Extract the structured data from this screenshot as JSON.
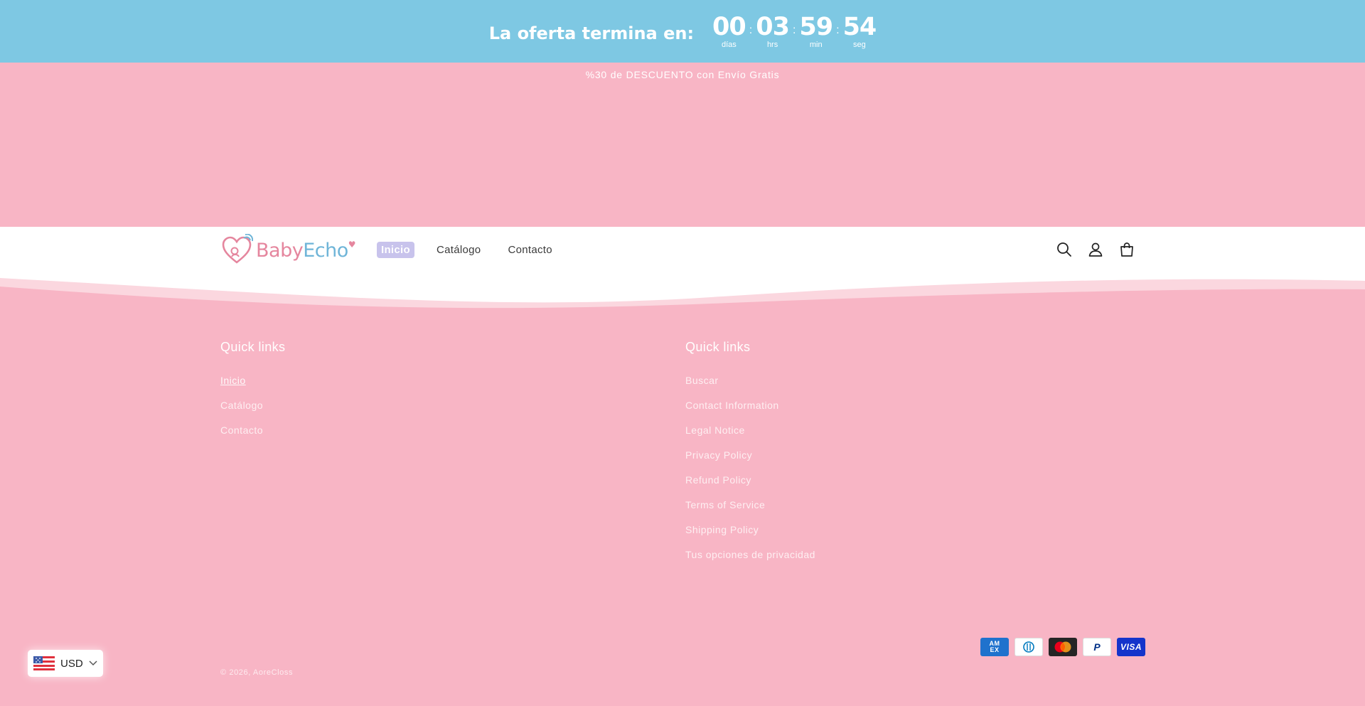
{
  "countdown": {
    "title": "La oferta termina en:",
    "days": {
      "value": "00",
      "label": "días"
    },
    "hours": {
      "value": "03",
      "label": "hrs"
    },
    "minutes": {
      "value": "59",
      "label": "min"
    },
    "seconds": {
      "value": "54",
      "label": "seg"
    },
    "separator": ":"
  },
  "announcement": "%30 de DESCUENTO con Envío Gratis",
  "header": {
    "logo": {
      "part1": "Baby",
      "part2": "Echo"
    },
    "nav": [
      {
        "label": "Inicio"
      },
      {
        "label": "Catálogo"
      },
      {
        "label": "Contacto"
      }
    ],
    "icons": [
      "search-icon",
      "account-icon",
      "cart-icon"
    ]
  },
  "footer": {
    "col1": {
      "title": "Quick links",
      "links": [
        "Inicio",
        "Catálogo",
        "Contacto"
      ]
    },
    "col2": {
      "title": "Quick links",
      "links": [
        "Buscar",
        "Contact Information",
        "Legal Notice",
        "Privacy Policy",
        "Refund Policy",
        "Terms of Service",
        "Shipping Policy",
        "Tus opciones de privacidad"
      ]
    },
    "copyright": "© 2026, AoreCloss",
    "payments": [
      {
        "name": "amex",
        "label": "AM EX"
      },
      {
        "name": "diners",
        "label": ""
      },
      {
        "name": "mastercard",
        "label": ""
      },
      {
        "name": "paypal",
        "label": "P"
      },
      {
        "name": "visa",
        "label": "VISA"
      }
    ]
  },
  "currency": {
    "code": "USD"
  },
  "colors": {
    "countdown_bg": "#7ec8e3",
    "page_bg": "#f8b5c5",
    "active_nav": "#c8c3ec",
    "logo_pink": "#e5869e",
    "logo_blue": "#6fb5d8"
  }
}
